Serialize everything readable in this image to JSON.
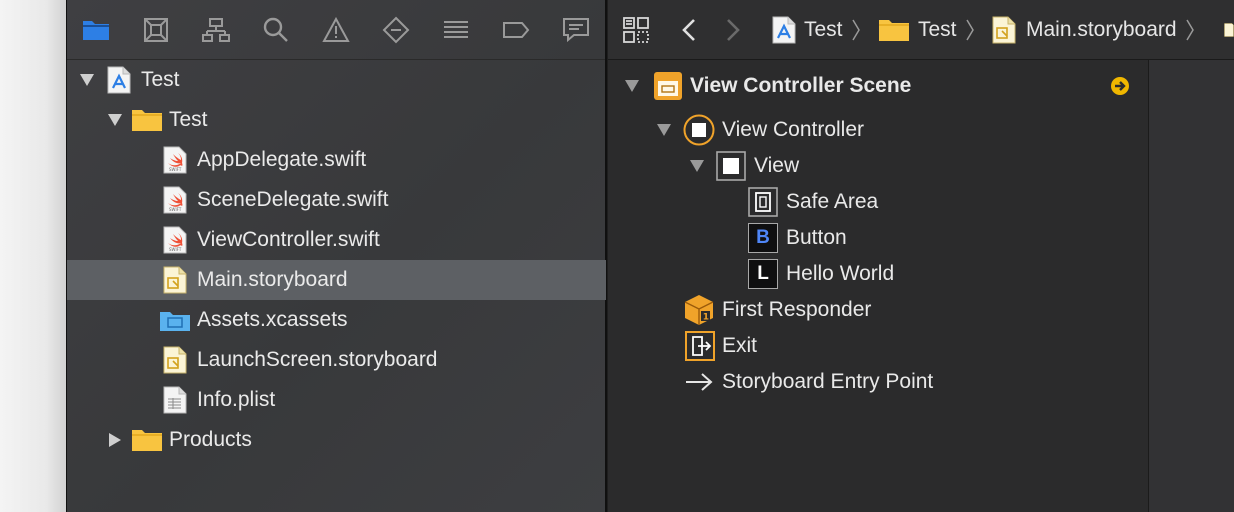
{
  "navigator": {
    "toolbar_icons": [
      "folder-icon",
      "source-control-icon",
      "hierarchy-icon",
      "search-icon",
      "warning-icon",
      "test-diamond-icon",
      "list-icon",
      "tag-icon",
      "message-icon"
    ],
    "tree": [
      {
        "label": "Test",
        "type": "project",
        "expanded": true
      },
      {
        "label": "Test",
        "type": "folder",
        "expanded": true
      },
      {
        "label": "AppDelegate.swift",
        "type": "swift"
      },
      {
        "label": "SceneDelegate.swift",
        "type": "swift"
      },
      {
        "label": "ViewController.swift",
        "type": "swift"
      },
      {
        "label": "Main.storyboard",
        "type": "storyboard",
        "selected": true
      },
      {
        "label": "Assets.xcassets",
        "type": "assets"
      },
      {
        "label": "LaunchScreen.storyboard",
        "type": "storyboard"
      },
      {
        "label": "Info.plist",
        "type": "plist"
      },
      {
        "label": "Products",
        "type": "folder",
        "expanded": false
      }
    ]
  },
  "editor": {
    "breadcrumbs": [
      "Test",
      "Test",
      "Main.storyboard"
    ],
    "outline": {
      "scene_title": "View Controller Scene",
      "view_controller": "View Controller",
      "view": "View",
      "safe_area": "Safe Area",
      "button": "Button",
      "button_glyph": "B",
      "label": "Hello World",
      "label_glyph": "L",
      "first_responder": "First Responder",
      "first_responder_glyph": "1",
      "exit": "Exit",
      "entry_point": "Storyboard Entry Point"
    }
  },
  "colors": {
    "accent_blue": "#2d7fe5",
    "folder_yellow": "#f8c440",
    "icon_orange": "#f0a32a",
    "selection": "#5d6064"
  }
}
